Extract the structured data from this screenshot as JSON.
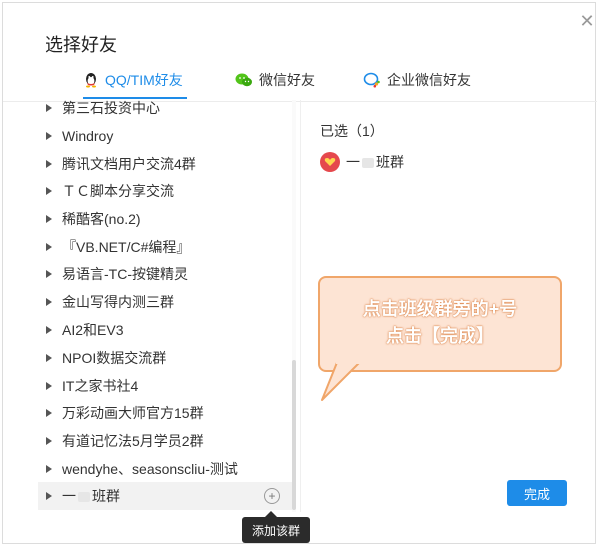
{
  "dialog": {
    "title": "选择好友",
    "close_icon": "close-icon"
  },
  "tabs": [
    {
      "label": "QQ/TIM好友",
      "icon": "qq-penguin-icon",
      "active": true
    },
    {
      "label": "微信好友",
      "icon": "wechat-icon",
      "active": false
    },
    {
      "label": "企业微信好友",
      "icon": "wecom-icon",
      "active": false
    }
  ],
  "groups": [
    {
      "label": "第三石投资中心"
    },
    {
      "label": "Windroy"
    },
    {
      "label": "腾讯文档用户交流4群"
    },
    {
      "label": "ＴＣ脚本分享交流"
    },
    {
      "label": "稀酷客(no.2)"
    },
    {
      "label": "『VB.NET/C#编程』"
    },
    {
      "label": "易语言-TC-按键精灵"
    },
    {
      "label": "金山写得内测三群"
    },
    {
      "label": "AI2和EV3"
    },
    {
      "label": "NPOI数据交流群"
    },
    {
      "label": "IT之家书社4"
    },
    {
      "label": "万彩动画大师官方15群"
    },
    {
      "label": "有道记忆法5月学员2群"
    },
    {
      "label": "wendyhe、seasonscliu-测试"
    },
    {
      "label_prefix": "一",
      "label_suffix": "班群",
      "hovered": true
    }
  ],
  "selected": {
    "header": "已选（1）",
    "items": [
      {
        "prefix": "一",
        "suffix": "班群"
      }
    ]
  },
  "callout": {
    "line1": "点击班级群旁的+号",
    "line2": "点击【完成】"
  },
  "buttons": {
    "done": "完成",
    "add_symbol": "+"
  },
  "tooltip": {
    "text": "添加该群"
  },
  "colors": {
    "accent": "#1e8ce8",
    "callout_fill": "#fde4d4",
    "callout_border": "#f0a66a",
    "avatar": "#e5484d"
  }
}
